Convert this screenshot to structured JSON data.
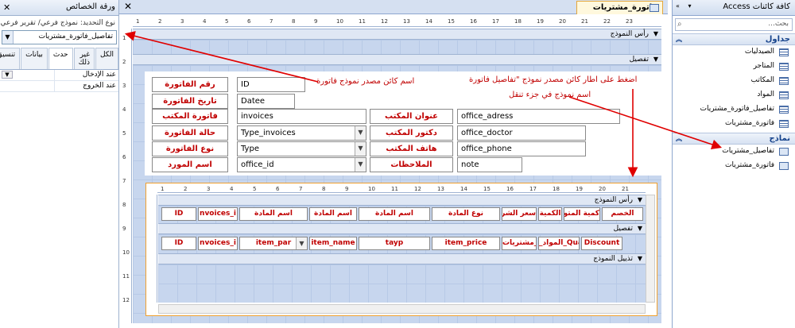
{
  "property_sheet": {
    "title": "ورقة الخصائص",
    "selection_type": "نوع التحديد: نموذج فرعي/ تقرير فرعي",
    "selected_object": "تفاصيل_فاتورة_مشتريات",
    "tabs": [
      "الكل",
      "غير ذلك",
      "حدث",
      "بيانات",
      "تنسيق"
    ],
    "rows": [
      {
        "key": "عند الإدخال",
        "value": ""
      },
      {
        "key": "عند الخروج",
        "value": ""
      }
    ]
  },
  "designer": {
    "tab_title": "فاتورة_مشتريات",
    "ruler_numbers": [
      "1",
      "2",
      "3",
      "4",
      "5",
      "6",
      "7",
      "8",
      "9",
      "10",
      "11",
      "12",
      "13",
      "14",
      "15",
      "16",
      "17",
      "18",
      "19",
      "20",
      "21",
      "22",
      "23"
    ],
    "vruler_numbers": [
      "1",
      "2",
      "3",
      "4",
      "5",
      "6",
      "7",
      "8",
      "9",
      "10",
      "11",
      "12"
    ],
    "sections": {
      "header": "رأس النموذج",
      "detail": "تفصيل"
    },
    "fields_right": [
      {
        "label": "رقم الفاتورة",
        "value": "ID",
        "combo": false
      },
      {
        "label": "تاريخ الفاتورة",
        "value": "Datee",
        "combo": false
      },
      {
        "label": "فاتورة المكتب",
        "value": "invoices",
        "combo": false
      },
      {
        "label": "حالة الفاتورة",
        "value": "Type_invoices",
        "combo": true
      },
      {
        "label": "نوع الفاتورة",
        "value": "Type",
        "combo": true
      },
      {
        "label": "اسم المورد",
        "value": "office_id",
        "combo": true
      }
    ],
    "fields_left": [
      {
        "label": "عنوان المكتب",
        "value": "office_adress"
      },
      {
        "label": "دكتور المكتب",
        "value": "office_doctor"
      },
      {
        "label": "هاتف المكتب",
        "value": "office_phone"
      },
      {
        "label": "الملاحظات",
        "value": "note"
      }
    ],
    "subform": {
      "ruler_numbers": [
        "1",
        "2",
        "3",
        "4",
        "5",
        "6",
        "7",
        "8",
        "9",
        "10",
        "11",
        "12",
        "13",
        "14",
        "15",
        "16",
        "17",
        "18",
        "19",
        "20",
        "21"
      ],
      "header": "رأس النموذج",
      "detail": "تفصيل",
      "footer": "تذييل النموذج",
      "header_labels": [
        "ID",
        "nvoices_i",
        "اسم المادة",
        "اسم المادة",
        "اسم المادة",
        "نوع المادة",
        "سعر الشراء",
        "الكمية",
        "كمية المتوف",
        "الخصم"
      ],
      "detail_fields": [
        "ID",
        "nvoices_i",
        "item_par",
        "item_name",
        "tayp",
        "item_price",
        "ة_مشتريات",
        "_المواد_Qua",
        "Discount"
      ]
    }
  },
  "annotations": {
    "source_note": "اسم كائن مصدر نموذج فاتورة",
    "drag_note_line1": "اضغط على اطار كائن مصدر نموذج \"تفاصيل فاتورة",
    "drag_note_line2": "اسم نموذج في جزء تنقل"
  },
  "navigation": {
    "header": "كافة كائنات Access",
    "search_placeholder": "بحث...",
    "groups": [
      {
        "title": "جداول",
        "items": [
          "الصيدليات",
          "المتاجر",
          "المكاتب",
          "المواد",
          "تفاصيل_فاتورة_مشتريات",
          "فاتورة_مشتريات"
        ]
      },
      {
        "title": "نماذج",
        "items": [
          "تفاصيل_مشتريات",
          "فاتورة_مشتريات"
        ]
      }
    ]
  },
  "colors": {
    "label_text": "#c00000",
    "grid": "#c7d6ee",
    "selection_border": "#f0a030",
    "arrow": "#e00000"
  }
}
